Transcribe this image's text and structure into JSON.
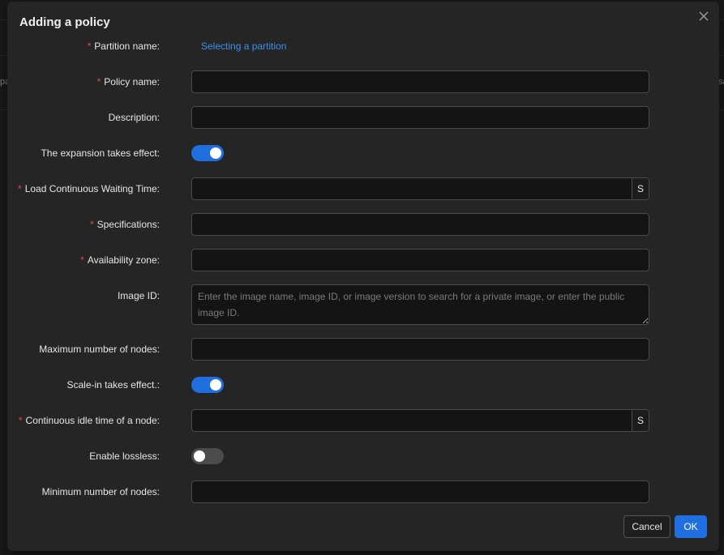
{
  "background": {
    "left_fragment": "pa",
    "right_fragment": "sa"
  },
  "dialog": {
    "title": "Adding a policy",
    "close_icon": "close-icon",
    "fields": {
      "partition": {
        "label": "Partition name:",
        "required": true,
        "link_text": "Selecting a partition"
      },
      "policy_name": {
        "label": "Policy name:",
        "required": true,
        "value": ""
      },
      "description": {
        "label": "Description:",
        "required": false,
        "value": ""
      },
      "expansion": {
        "label": "The expansion takes effect:",
        "required": false,
        "enabled": true
      },
      "load_wait": {
        "label": "Load Continuous Waiting Time:",
        "required": true,
        "value": "",
        "unit": "S"
      },
      "specifications": {
        "label": "Specifications:",
        "required": true,
        "value": ""
      },
      "availability_zone": {
        "label": "Availability zone:",
        "required": true,
        "value": ""
      },
      "image_id": {
        "label": "Image ID:",
        "required": false,
        "value": "",
        "placeholder": "Enter the image name, image ID, or image version to search for a private image, or enter the public image ID."
      },
      "max_nodes": {
        "label": "Maximum number of nodes:",
        "required": false,
        "value": ""
      },
      "scale_in": {
        "label": "Scale-in takes effect.:",
        "required": false,
        "enabled": true
      },
      "idle_time": {
        "label": "Continuous idle time of a node:",
        "required": true,
        "value": "",
        "unit": "S"
      },
      "lossless": {
        "label": "Enable lossless:",
        "required": false,
        "enabled": false
      },
      "min_nodes": {
        "label": "Minimum number of nodes:",
        "required": false,
        "value": ""
      }
    },
    "buttons": {
      "cancel": "Cancel",
      "ok": "OK"
    }
  },
  "colors": {
    "accent": "#1f6fe0",
    "link": "#3b8ff0",
    "required": "#e5484d",
    "dialog_bg": "#252526",
    "input_bg": "#141414"
  }
}
